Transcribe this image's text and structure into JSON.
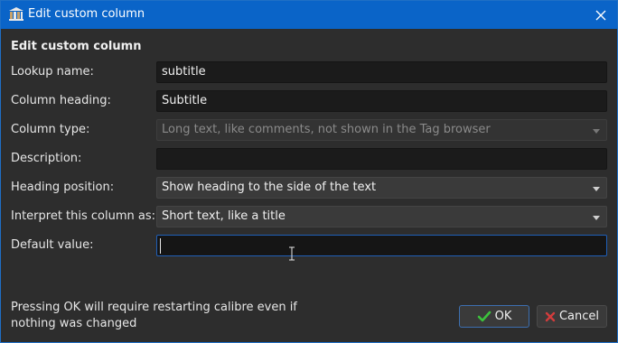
{
  "window": {
    "title": "Edit custom column",
    "accent": "#0a64c8"
  },
  "section_title": "Edit custom column",
  "fields": {
    "lookup_name": {
      "label": "Lookup name:",
      "value": "subtitle"
    },
    "column_heading": {
      "label": "Column heading:",
      "value": "Subtitle"
    },
    "column_type": {
      "label": "Column type:",
      "value": "Long text, like comments, not shown in the Tag browser",
      "disabled": true
    },
    "description": {
      "label": "Description:",
      "value": ""
    },
    "heading_position": {
      "label": "Heading position:",
      "value": "Show heading to the side of the text"
    },
    "interpret_as": {
      "label": "Interpret this column as:",
      "value": "Short text, like a title"
    },
    "default_value": {
      "label": "Default value:",
      "value": ""
    }
  },
  "footer": {
    "note": "Pressing OK will require restarting calibre even if nothing was changed",
    "ok_label": "OK",
    "cancel_label": "Cancel"
  },
  "icons": {
    "app": "calibre-library-icon",
    "close": "close-icon",
    "ok": "checkmark-icon",
    "cancel": "x-icon",
    "cursor": "text-cursor-icon"
  },
  "colors": {
    "ok_check": "#3cc23c",
    "cancel_x": "#d23c3c"
  }
}
